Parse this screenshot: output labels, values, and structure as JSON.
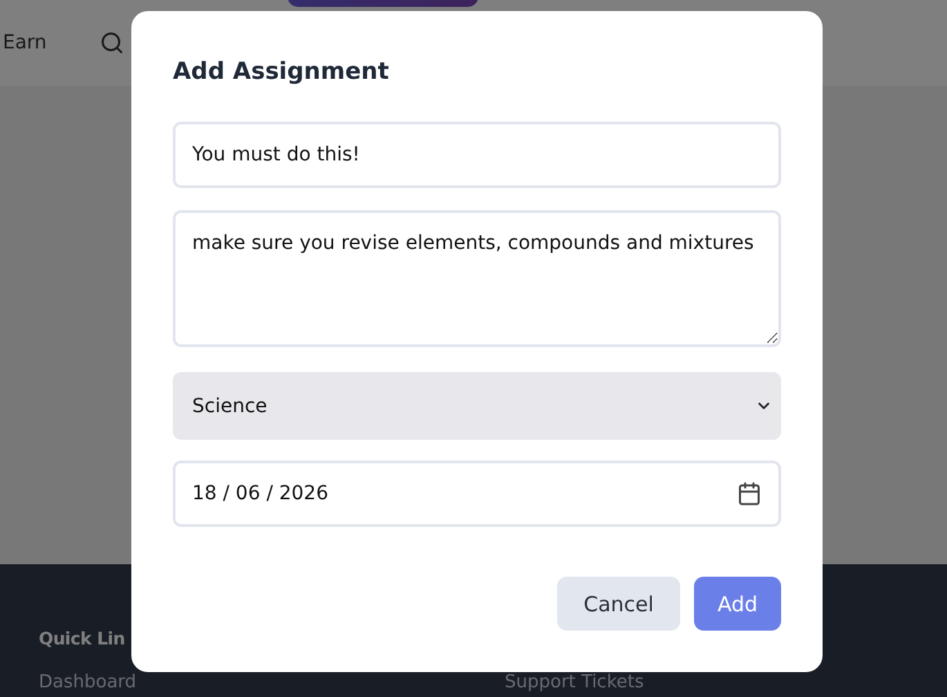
{
  "navbar": {
    "links": [
      "Earn"
    ]
  },
  "dialog": {
    "title": "Add Assignment",
    "title_field": {
      "value": "You must do this!"
    },
    "description_field": {
      "value": "make sure you revise elements, compounds and mixtures"
    },
    "subject_select": {
      "value": "Science"
    },
    "due_date_field": {
      "value": "18 / 06 / 2026"
    },
    "buttons": [
      {
        "label": "Cancel",
        "kind": "secondary"
      },
      {
        "label": "Add",
        "kind": "primary"
      }
    ]
  },
  "footer": {
    "heading": "Quick Lin",
    "links": [
      "Dashboard",
      "Support Tickets"
    ]
  }
}
